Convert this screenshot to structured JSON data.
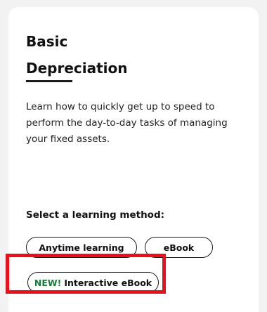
{
  "card": {
    "title_line1": "Basic",
    "title_line2": "Depreciation",
    "description": "Learn how to quickly get up to speed to perform the day-to-day tasks of managing your fixed assets."
  },
  "learning": {
    "label": "Select a learning method:",
    "options": [
      {
        "label": "Anytime learning"
      },
      {
        "label": "eBook"
      },
      {
        "badge": "NEW!",
        "label": "Interactive eBook"
      }
    ]
  },
  "colors": {
    "highlight": "#e8101a",
    "new_badge": "#1a7a3c"
  }
}
